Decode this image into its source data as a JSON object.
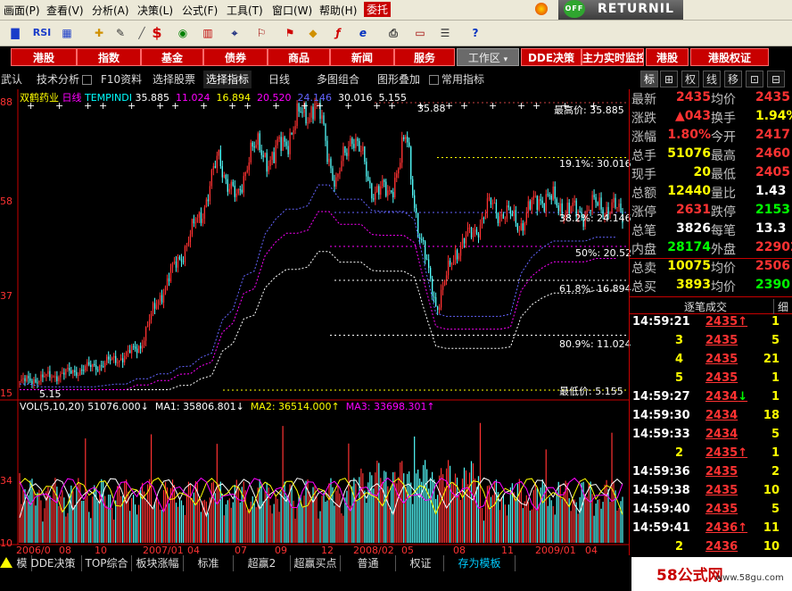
{
  "menu": {
    "items": [
      "画面(P)",
      "查看(V)",
      "分析(A)",
      "决策(L)",
      "公式(F)",
      "工具(T)",
      "窗口(W)",
      "帮助(H)",
      "委托"
    ]
  },
  "returnil": {
    "badge": "OFF",
    "title": "RETURNIL"
  },
  "toolbar": {
    "icons": [
      {
        "name": "kline-icon",
        "glyph": "▇"
      },
      {
        "name": "rsi-icon",
        "glyph": "RSI"
      },
      {
        "name": "grid-icon",
        "glyph": "▦"
      },
      {
        "name": "add-icon",
        "glyph": "✚"
      },
      {
        "name": "pen-icon",
        "glyph": "✎"
      },
      {
        "name": "ruler-icon",
        "glyph": "📏"
      },
      {
        "name": "dollar-icon",
        "glyph": "$"
      },
      {
        "name": "eye-icon",
        "glyph": "◉"
      },
      {
        "name": "bars-icon",
        "glyph": "▥"
      },
      {
        "name": "binoculars-icon",
        "glyph": "⌖"
      },
      {
        "name": "bell-icon",
        "glyph": "⚐"
      },
      {
        "name": "flag-icon",
        "glyph": "⚑"
      },
      {
        "name": "diamond-icon",
        "glyph": "◆"
      },
      {
        "name": "circle-f-icon",
        "glyph": "ƒ"
      },
      {
        "name": "circle-e-icon",
        "glyph": "e"
      },
      {
        "name": "print-icon",
        "glyph": "⎙"
      },
      {
        "name": "window-icon",
        "glyph": "▭"
      },
      {
        "name": "menu-icon",
        "glyph": "☰"
      },
      {
        "name": "help-icon",
        "glyph": "?"
      }
    ]
  },
  "funcbar": {
    "items": [
      "港股",
      "指数",
      "基金",
      "债券",
      "商品",
      "新闻",
      "服务"
    ],
    "workspace": "工作区",
    "right": [
      "DDE决策",
      "主力实时监控",
      "港股",
      "港股权证"
    ]
  },
  "tabbar": {
    "items": [
      "武认",
      "技术分析",
      "F10资料",
      "选择股票",
      "选择指标",
      "日线",
      "多图组合",
      "图形叠加",
      "常用指标"
    ]
  },
  "righttabs": {
    "items": [
      "标",
      "⊞",
      "权",
      "线",
      "移",
      "⊡",
      "⊟"
    ]
  },
  "chart": {
    "stock_name": "双鹤药业",
    "period": "日线",
    "indicator_name": "TEMPINDI",
    "indicator_values": [
      "35.885",
      "11.024",
      "16.894",
      "20.520",
      "24.146",
      "30.016",
      "5.155"
    ],
    "vol_label": "VOL(5,10,20)",
    "vol_value": "51076.000↓",
    "ma1": "MA1: 35806.801↓",
    "ma2": "MA2: 36514.000↑",
    "ma3": "MA3: 33698.301↑",
    "fib_labels": [
      "最高价: 35.885",
      "19.1%: 30.016",
      "38.2%: 24.146",
      "50%: 20.52",
      "61.8%: 16.894",
      "80.9%: 11.024",
      "最低价: 5.155"
    ],
    "price_axis": [
      "88",
      "58",
      "37",
      "15"
    ],
    "vol_axis": [
      "34",
      "10"
    ],
    "marker": "35.88",
    "low_marker": "5.15",
    "date_axis": [
      "2006/0",
      "08",
      "10",
      "2007/01",
      "04",
      "07",
      "09",
      "12",
      "2008/02",
      "05",
      "08",
      "11",
      "2009/01",
      "04"
    ],
    "colors": {
      "up": "#FF3232",
      "down": "#54FFFF",
      "ma1": "#FFFFFF",
      "ma2": "#FFFF00",
      "ma3": "#FF00FF"
    }
  },
  "quote": {
    "rows": [
      {
        "l": "最新",
        "v": "2435",
        "l2": "均价",
        "v2": "2435",
        "c": "#FF3232"
      },
      {
        "l": "涨跌",
        "v": "▲043",
        "l2": "换手",
        "v2": "1.94%",
        "c": "#FF3232",
        "c2": "#FFFF00"
      },
      {
        "l": "涨幅",
        "v": "1.80%",
        "l2": "今开",
        "v2": "2417",
        "c": "#FF3232"
      },
      {
        "l": "总手",
        "v": "51076",
        "l2": "最高",
        "v2": "2460",
        "c": "#FFFF00",
        "c2b": "#FF3232"
      },
      {
        "l": "现手",
        "v": "20",
        "l2": "最低",
        "v2": "2405",
        "c": "#FFFF00",
        "c2b": "#FF3232"
      },
      {
        "l": "总额",
        "v": "12440",
        "l2": "量比",
        "v2": "1.43",
        "c": "#FFFF00",
        "c2b": "#FFFFFF"
      },
      {
        "l": "涨停",
        "v": "2631",
        "l2": "跌停",
        "v2": "2153",
        "c": "#FF3232",
        "c2b": "#00FF00"
      },
      {
        "l": "总笔",
        "v": "3826",
        "l2": "每笔",
        "v2": "13.3",
        "c": "#FFFFFF",
        "c2b": "#FFFFFF"
      },
      {
        "l": "内盘",
        "v": "28174",
        "l2": "外盘",
        "v2": "22902",
        "c": "#00FF00",
        "c2b": "#FF3232"
      },
      {
        "l": "总卖",
        "v": "10075",
        "l2": "均价",
        "v2": "2506",
        "c": "#FFFF00",
        "c2b": "#FF3232"
      },
      {
        "l": "总买",
        "v": "3893",
        "l2": "均价",
        "v2": "2390",
        "c": "#FFFF00",
        "c2b": "#00FF00"
      }
    ],
    "ticks_title": "逐笔成交",
    "ticks_tab": "细",
    "ticks": [
      {
        "t": "14:59:21",
        "p": "2435↑",
        "v": "1"
      },
      {
        "t": "3",
        "p": "2435",
        "v": "5"
      },
      {
        "t": "4",
        "p": "2435",
        "v": "21"
      },
      {
        "t": "5",
        "p": "2435",
        "v": "1"
      },
      {
        "t": "14:59:27",
        "p": "2434↓",
        "v": "1"
      },
      {
        "t": "14:59:30",
        "p": "2434",
        "v": "18"
      },
      {
        "t": "14:59:33",
        "p": "2434",
        "v": "5"
      },
      {
        "t": "2",
        "p": "2435↑",
        "v": "1"
      },
      {
        "t": "14:59:36",
        "p": "2435",
        "v": "2"
      },
      {
        "t": "14:59:38",
        "p": "2435",
        "v": "10"
      },
      {
        "t": "14:59:40",
        "p": "2435",
        "v": "5"
      },
      {
        "t": "14:59:41",
        "p": "2436↑",
        "v": "11"
      },
      {
        "t": "2",
        "p": "2436",
        "v": "10"
      }
    ]
  },
  "bottombar": {
    "items": [
      "模板",
      "DDE决策",
      "TOP综合",
      "板块涨幅",
      "标准",
      "超赢2",
      "超赢买点",
      "普通",
      "权证",
      "存为模板"
    ]
  },
  "watermark": {
    "site": "58公式网",
    "url": "www.58gu.com"
  }
}
